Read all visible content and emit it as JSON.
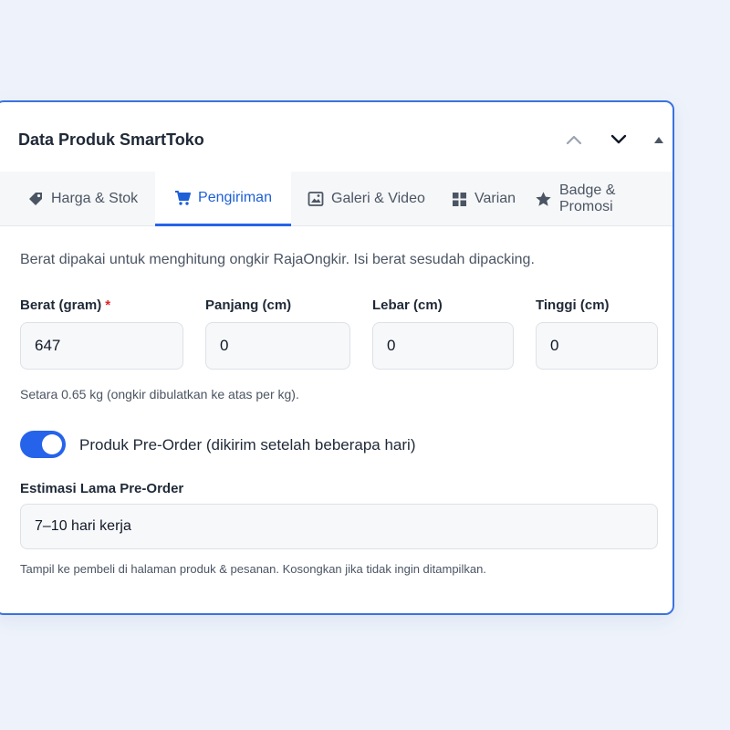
{
  "panel": {
    "title": "Data Produk SmartToko",
    "controls": [
      "chevron-up-icon",
      "chevron-down-icon",
      "triangle-up-icon"
    ]
  },
  "tabs": [
    {
      "label": "Harga & Stok",
      "icon": "tag-icon",
      "active": false
    },
    {
      "label": "Pengiriman",
      "icon": "cart-icon",
      "active": true
    },
    {
      "label": "Galeri & Video",
      "icon": "image-icon",
      "active": false
    },
    {
      "label": "Varian",
      "icon": "grid-icon",
      "active": false
    },
    {
      "label": "Badge & Promosi",
      "icon": "star-icon",
      "active": false
    }
  ],
  "shipping": {
    "description": "Berat dipakai untuk menghitung ongkir RajaOngkir. Isi berat sesudah dipacking.",
    "fields": [
      {
        "label": "Berat (gram)",
        "required_mark": "*",
        "value": "647"
      },
      {
        "label": "Panjang (cm)",
        "value": "0"
      },
      {
        "label": "Lebar (cm)",
        "value": "0"
      },
      {
        "label": "Tinggi (cm)",
        "value": "0"
      }
    ],
    "weight_hint": "Setara 0.65 kg (ongkir dibulatkan ke atas per kg).",
    "preorder": {
      "enabled": true,
      "label": "Produk Pre-Order (dikirim setelah beberapa hari)"
    },
    "estimate": {
      "label": "Estimasi Lama Pre-Order",
      "value": "7–10 hari kerja",
      "hint": "Tampil ke pembeli di halaman produk & pesanan. Kosongkan jika tidak ingin ditampilkan."
    }
  },
  "colors": {
    "accent": "#2563eb",
    "border": "#3b73e0",
    "required": "#dc2626"
  }
}
